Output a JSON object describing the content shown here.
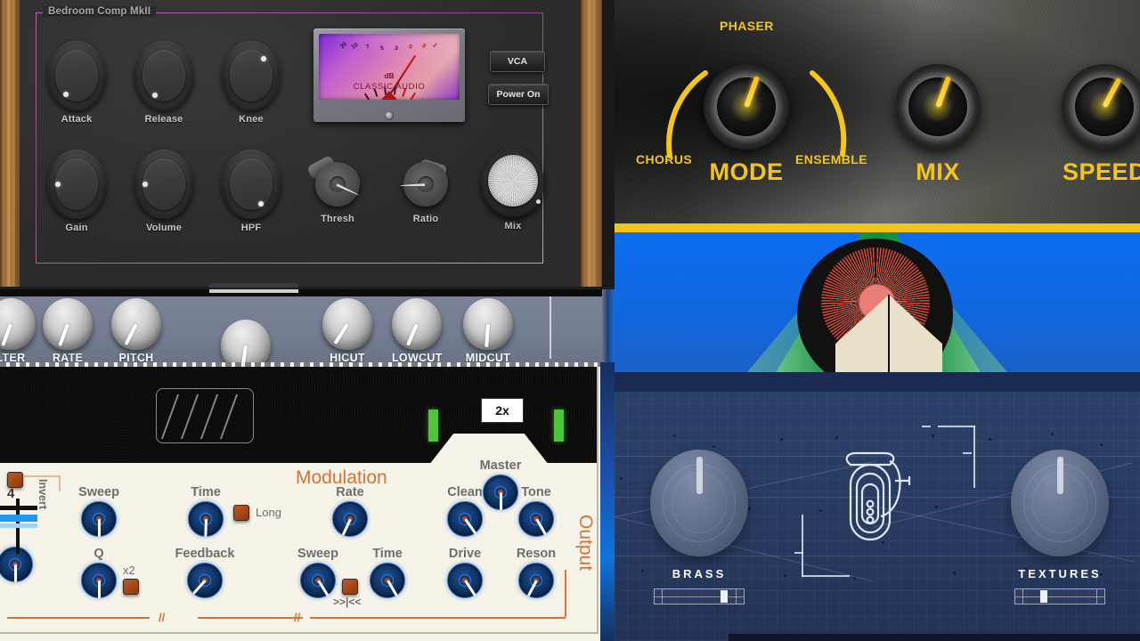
{
  "comp_panel": {
    "group_title": "Bedroom Comp MkII",
    "knobs_row1": [
      {
        "label": "Attack",
        "angle": 214
      },
      {
        "label": "Release",
        "angle": 208
      },
      {
        "label": "Knee",
        "angle": 42
      }
    ],
    "knobs_row2": [
      {
        "label": "Gain",
        "angle": 270
      },
      {
        "label": "Volume",
        "angle": 270
      },
      {
        "label": "HPF",
        "angle": 150
      }
    ],
    "pointer_knobs": [
      {
        "label": "Thresh",
        "angle": 45
      },
      {
        "label": "Ratio",
        "angle": 198
      }
    ],
    "metal_knob": {
      "label": "Mix",
      "angle": 135
    },
    "buttons": [
      {
        "name": "vca",
        "label": "VCA"
      },
      {
        "name": "power",
        "label": "Power On"
      }
    ],
    "vu": {
      "unit": "dB",
      "brand": "CLASSIC AUDIO",
      "ticks": [
        "20",
        "10",
        "7",
        "5",
        "3",
        "0",
        "3",
        "1"
      ],
      "needle_angle": 33
    }
  },
  "phaser_panel": {
    "mode": {
      "caption": "MODE",
      "positions": [
        "CHORUS",
        "PHASER",
        "ENSEMBLE"
      ],
      "selected": "PHASER",
      "angle": 200
    },
    "knobs": [
      {
        "caption": "MIX",
        "angle": 200
      },
      {
        "caption": "SPEED",
        "angle": 208
      }
    ],
    "accent_color": "#f5c518"
  },
  "strip_panel": {
    "knobs": [
      {
        "label": "LTER",
        "angle": 200,
        "truncated": true
      },
      {
        "label": "RATE",
        "angle": 200
      },
      {
        "label": "PITCH",
        "angle": 207
      },
      {
        "label": "",
        "angle": 188
      },
      {
        "label": "HICUT",
        "angle": 212
      },
      {
        "label": "LOWCUT",
        "angle": 203
      },
      {
        "label": "MIDCUT",
        "angle": 184
      }
    ]
  },
  "modulation_panel": {
    "section_titles": {
      "modulation": "Modulation",
      "output": "Output",
      "invert": "Invert"
    },
    "peak_badge": "2x",
    "left_column": {
      "divisor_label": "4",
      "invert_button": "invert-toggle"
    },
    "knobs": [
      {
        "label": "Sweep",
        "angle": 180
      },
      {
        "label": "Time",
        "angle": 182
      },
      {
        "label": "Rate",
        "angle": 205
      },
      {
        "label": "Master",
        "angle": 180
      },
      {
        "label": "Clean",
        "angle": 145
      },
      {
        "label": "Tone",
        "angle": 150
      },
      {
        "label": "Q",
        "angle": 180
      },
      {
        "label": "Feedback",
        "angle": 222
      },
      {
        "label": "Sweep",
        "angle": 148
      },
      {
        "label": "Time",
        "angle": 150
      },
      {
        "label": "Drive",
        "angle": 147
      },
      {
        "label": "Reson",
        "angle": 208
      },
      {
        "label": "",
        "angle": 180
      }
    ],
    "toggles": [
      {
        "label": "Long",
        "name": "long-toggle"
      },
      {
        "label": "x2",
        "name": "x2-toggle"
      },
      {
        "label": ">>|<<",
        "name": "sync-toggle"
      }
    ],
    "rail_marks": [
      "//",
      "//"
    ]
  },
  "blueprint_panel": {
    "left_knob_label": "BRASS",
    "right_knob_label": "TEXTURES",
    "diagram": "tuba-outline"
  }
}
